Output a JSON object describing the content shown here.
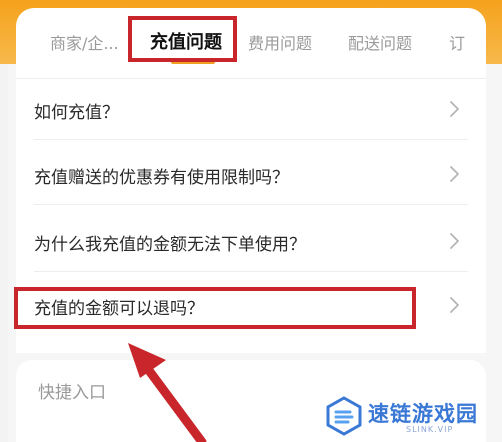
{
  "tabs": [
    {
      "label": "商家/企..."
    },
    {
      "label": "充值问题"
    },
    {
      "label": "费用问题"
    },
    {
      "label": "配送问题"
    },
    {
      "label": "订"
    }
  ],
  "active_tab_index": 1,
  "faq": [
    {
      "label": "如何充值？"
    },
    {
      "label": "充值赠送的优惠券有使用限制吗？"
    },
    {
      "label": "为什么我充值的金额无法下单使用？"
    },
    {
      "label": "充值的金额可以退吗？"
    }
  ],
  "quick_entry": {
    "label": "快捷入口"
  },
  "watermark": {
    "title": "速链游戏园",
    "subtitle": "SLINK.VIP"
  },
  "colors": {
    "accent": "#f0a020",
    "highlight": "#c8262a",
    "header_gradient_top": "#f5a21d",
    "watermark_blue": "#3a78d6"
  },
  "icons": {
    "faq_row": "chevron-right-icon",
    "annotation": "red-arrow-icon",
    "watermark": "watermark-logo-icon"
  }
}
